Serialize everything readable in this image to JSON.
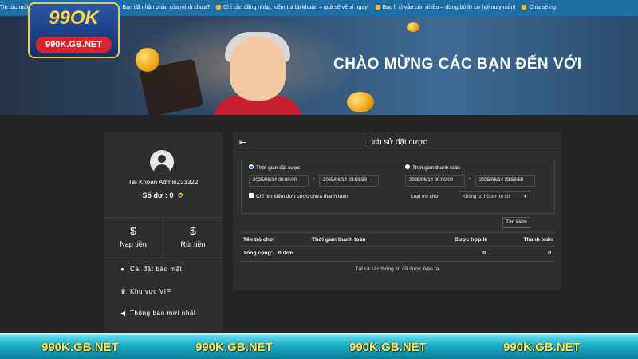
{
  "ticker": [
    "Tin tức mới",
    "Bạn đã nhận phần của mình chưa?",
    "Chỉ cần đăng nhập, kiểm tra tài khoản – quà sẽ về ví ngay!",
    "Bao lì xì vẫn còn nhiều – đừng bỏ lỡ cơ hội may mắn!",
    "Chia sẻ ng"
  ],
  "logo": {
    "brand": "99OK",
    "url": "990K.GB.NET"
  },
  "banner": {
    "welcome": "CHÀO MỪNG CÁC BẠN ĐẾN VỚI"
  },
  "sidebar": {
    "account": "Tài Khoản Admin233322",
    "balance_label": "Số dư :",
    "balance_value": "0",
    "deposit": "Nạp tiền",
    "withdraw": "Rút tiền",
    "menu": [
      "Cài đặt bảo mật",
      "Khu vực VIP",
      "Thông báo mới nhất"
    ]
  },
  "panel": {
    "title": "Lịch sử đặt cược",
    "bet_time_label": "Thời gian đặt cược",
    "pay_time_label": "Thời gian thanh toán",
    "bet_from": "2025/06/14 00:00:00",
    "bet_to": "2025/06/14 23:59:59",
    "pay_from": "2025/06/14 00:00:00",
    "pay_to": "2025/06/14 23:59:59",
    "unpaid_only": "Chỉ tìm kiếm đơn cược chưa thanh toán",
    "game_type_label": "Loại trò chơi",
    "game_type_value": "Không có hồ sơ trò ch",
    "search_button": "Tìm kiếm",
    "dash": "-",
    "columns": [
      "Tên trò chơi",
      "Thời gian thanh toán",
      "Cược hợp lệ",
      "Thanh toán"
    ],
    "total_label": "Tổng cộng:",
    "total_orders": "0 đơn",
    "total_valid": "0",
    "total_payout": "0",
    "note": "Tất cả các thông tin đã được hiện ra"
  },
  "footer": {
    "brand": "990K.GB.NET"
  },
  "colors": {
    "ticker": "#1d6fa5",
    "background": "#222425",
    "panel": "#2c2e30",
    "footer_text": "#ffe45a",
    "footer_bar": "#19aac3",
    "logo_red": "#d9232d"
  }
}
